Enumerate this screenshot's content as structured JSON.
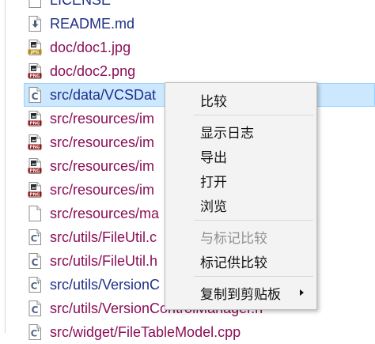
{
  "files": [
    {
      "name": "LICENSE",
      "icon": "blank-file-icon",
      "status": "committed"
    },
    {
      "name": "README.md",
      "icon": "markdown-file-icon",
      "status": "committed"
    },
    {
      "name": "doc/doc1.jpg",
      "icon": "jpg-image-icon",
      "status": "modified"
    },
    {
      "name": "doc/doc2.png",
      "icon": "png-image-icon",
      "status": "modified"
    },
    {
      "name": "src/data/VCSDat",
      "icon": "c-source-icon",
      "status": "committed",
      "selected": true
    },
    {
      "name": "src/resources/im",
      "icon": "png-image-icon",
      "status": "modified"
    },
    {
      "name": "src/resources/im",
      "icon": "png-image-icon",
      "status": "modified"
    },
    {
      "name": "src/resources/im",
      "icon": "png-image-icon",
      "status": "modified"
    },
    {
      "name": "src/resources/im",
      "icon": "png-image-icon",
      "status": "modified"
    },
    {
      "name": "src/resources/ma",
      "icon": "blank-file-icon",
      "status": "modified"
    },
    {
      "name": "src/utils/FileUtil.c",
      "icon": "cpp-source-icon",
      "status": "modified"
    },
    {
      "name": "src/utils/FileUtil.h",
      "icon": "c-source-icon",
      "status": "modified"
    },
    {
      "name": "src/utils/VersionC",
      "icon": "cpp-source-icon",
      "status": "committed"
    },
    {
      "name": "src/utils/VersionControlManager.h",
      "icon": "c-source-icon",
      "status": "modified"
    },
    {
      "name": "src/widget/FileTableModel.cpp",
      "icon": "cpp-source-icon",
      "status": "modified"
    }
  ],
  "context_menu": {
    "items": [
      {
        "label": "比较",
        "enabled": true
      },
      {
        "separator": true
      },
      {
        "label": "显示日志",
        "enabled": true
      },
      {
        "label": "导出",
        "enabled": true
      },
      {
        "label": "打开",
        "enabled": true
      },
      {
        "label": "浏览",
        "enabled": true
      },
      {
        "separator": true
      },
      {
        "label": "与标记比较",
        "enabled": false
      },
      {
        "label": "标记供比较",
        "enabled": true
      },
      {
        "separator": true
      },
      {
        "label": "复制到剪贴板",
        "enabled": true,
        "submenu": true
      }
    ]
  },
  "colors": {
    "committed_text": "#1f2f86",
    "modified_text": "#8b0d57",
    "selection_bg": "#cce8ff",
    "menu_bg": "#f3f3f3"
  }
}
